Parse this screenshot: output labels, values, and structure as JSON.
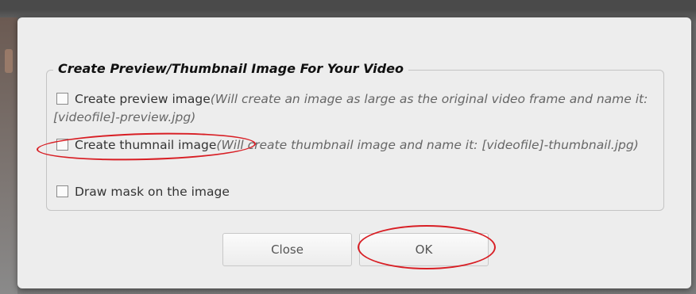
{
  "dialog": {
    "legend": "Create Preview/Thumbnail Image For Your Video",
    "options": [
      {
        "label": "Create preview image",
        "hint": "(Will create an image as large as the original video frame and name it: [videofile]-preview.jpg)",
        "checked": false
      },
      {
        "label": "Create thumnail image",
        "hint": "(Will create thumbnail image and name it: [videofile]-thumbnail.jpg)",
        "checked": false
      },
      {
        "label": "Draw mask on the image",
        "hint": "",
        "checked": false
      }
    ],
    "buttons": {
      "close": "Close",
      "ok": "OK"
    }
  },
  "annotations": {
    "color": "#d81e24"
  }
}
